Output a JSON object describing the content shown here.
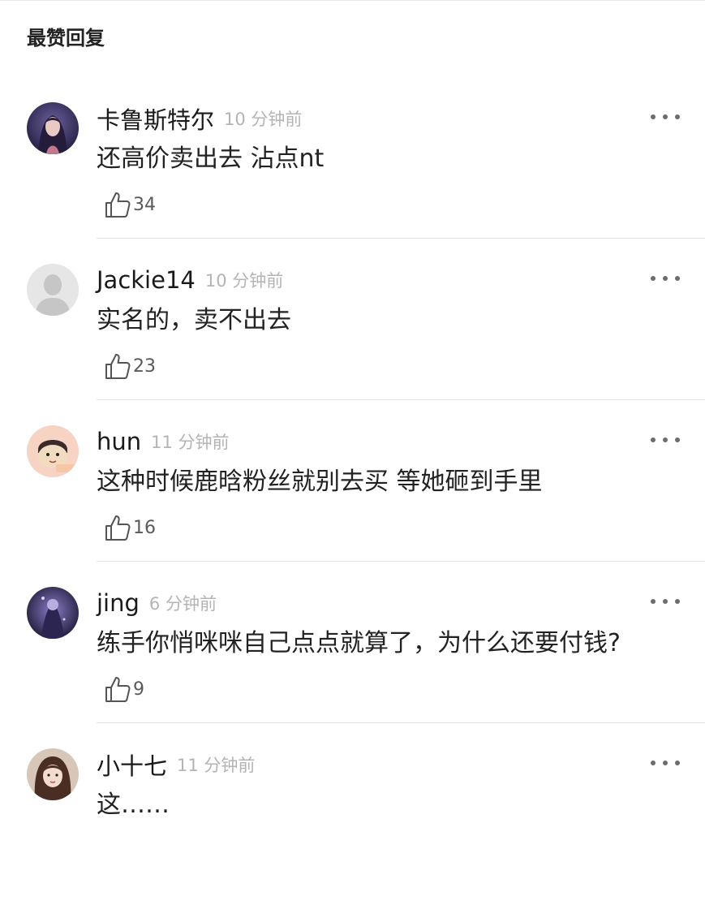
{
  "section": {
    "title": "最赞回复"
  },
  "comments": [
    {
      "username": "卡鲁斯特尔",
      "time": "10 分钟前",
      "text": "还高价卖出去 沾点nt",
      "likes": "34",
      "avatar_icon": "dark-fantasy-character-avatar"
    },
    {
      "username": "Jackie14",
      "time": "10 分钟前",
      "text": "实名的，卖不出去",
      "likes": "23",
      "avatar_icon": "default-gray-person-avatar"
    },
    {
      "username": "hun",
      "time": "11 分钟前",
      "text": "这种时候鹿晗粉丝就别去买 等她砸到手里",
      "likes": "16",
      "avatar_icon": "cartoon-boy-avatar"
    },
    {
      "username": "jing",
      "time": "6 分钟前",
      "text": "练手你悄咪咪自己点点就算了，为什么还要付钱?",
      "likes": "9",
      "avatar_icon": "dark-purple-figure-avatar"
    },
    {
      "username": "小十七",
      "time": "11 分钟前",
      "text": "这……",
      "likes": "",
      "avatar_icon": "girl-photo-avatar"
    }
  ],
  "icons": {
    "like": "thumbs-up-outline-icon",
    "more": "more-dots-icon"
  }
}
